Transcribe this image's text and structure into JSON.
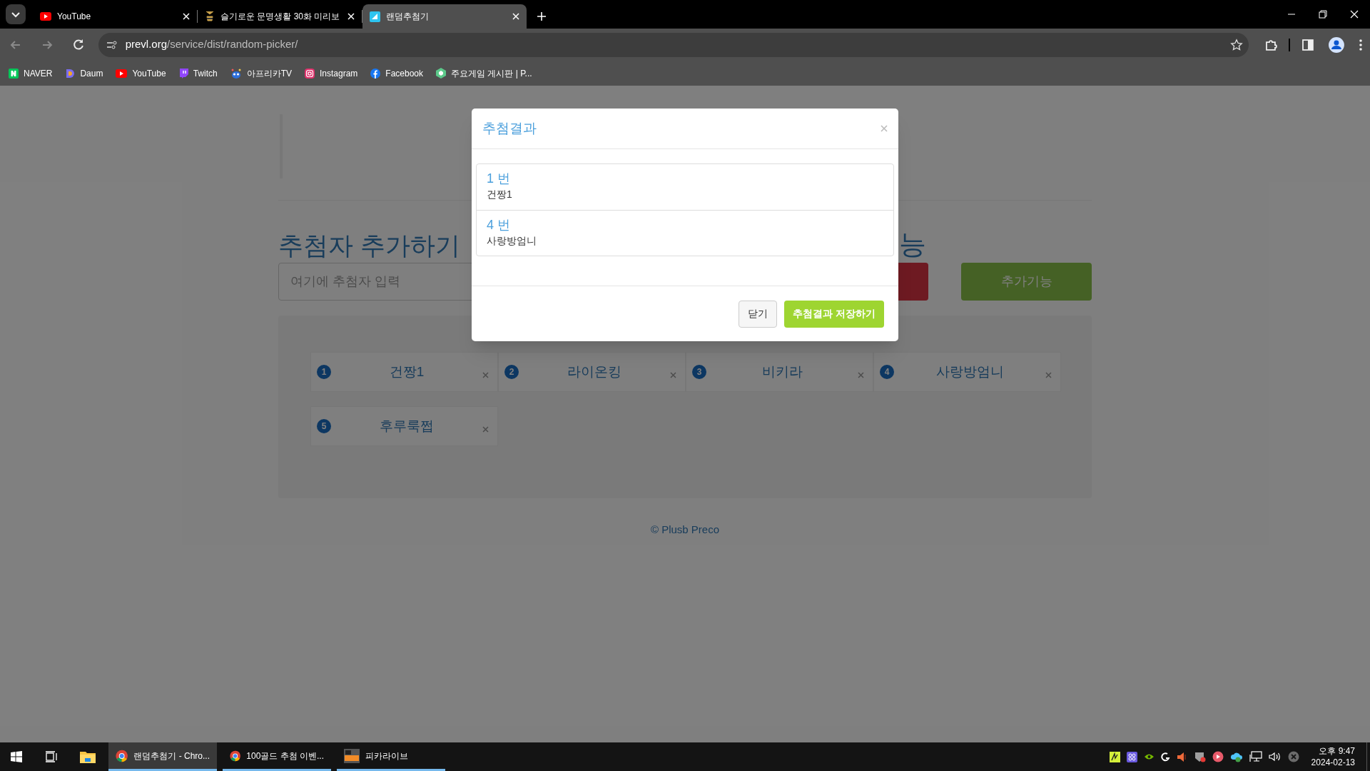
{
  "browser": {
    "tabs": [
      {
        "title": "YouTube",
        "kind": "youtube",
        "selected": false
      },
      {
        "title": "슬기로운 문명생활 30화 미리보",
        "kind": "bee",
        "selected": false
      },
      {
        "title": "랜덤추첨기",
        "kind": "picker",
        "selected": true
      }
    ],
    "address": {
      "domain": "prevl.org",
      "path": "/service/dist/random-picker/"
    },
    "bookmarks": [
      {
        "label": "NAVER",
        "kind": "naver"
      },
      {
        "label": "Daum",
        "kind": "daum"
      },
      {
        "label": "YouTube",
        "kind": "youtube"
      },
      {
        "label": "Twitch",
        "kind": "twitch"
      },
      {
        "label": "아프리카TV",
        "kind": "afreeca"
      },
      {
        "label": "Instagram",
        "kind": "instagram"
      },
      {
        "label": "Facebook",
        "kind": "facebook"
      },
      {
        "label": "주요게임 게시판 | P...",
        "kind": "game"
      }
    ]
  },
  "page": {
    "heading": "추첨자 추가하기",
    "heading_tail": "능",
    "input_placeholder": "여기에 추첨자 입력",
    "extra_button": "추가기능",
    "items": [
      {
        "number": "1",
        "name": "건짱1"
      },
      {
        "number": "2",
        "name": "라이온킹"
      },
      {
        "number": "3",
        "name": "비키라"
      },
      {
        "number": "4",
        "name": "사랑방엄니"
      },
      {
        "number": "5",
        "name": "후루룩쩝"
      }
    ],
    "footer": "© Plusb Preco"
  },
  "modal": {
    "title": "추첨결과",
    "results": [
      {
        "number": "1 번",
        "name": "건짱1"
      },
      {
        "number": "4 번",
        "name": "사랑방엄니"
      }
    ],
    "buttons": [
      {
        "label": "닫기",
        "kind": "default"
      },
      {
        "label": "추첨결과 저장하기",
        "kind": "primary"
      }
    ]
  },
  "taskbar": {
    "apps": [
      {
        "label": "랜덤추첨기 - Chro...",
        "kind": "chrome",
        "selected": true
      },
      {
        "label": "100골드 추첨 이벤...",
        "kind": "chrome",
        "selected": false
      },
      {
        "label": "피카라이브",
        "kind": "pica",
        "selected": false
      }
    ],
    "time": "오후 9:47",
    "date": "2024-02-13"
  }
}
